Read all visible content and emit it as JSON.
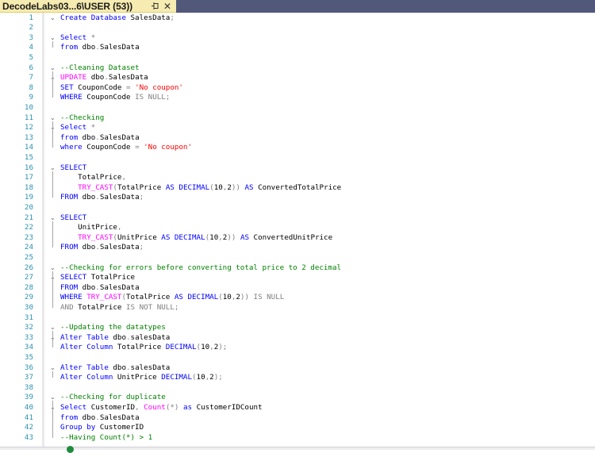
{
  "tab": {
    "title": "DecodeLabs03...6\\USER (53))",
    "pin_icon": "pin-icon",
    "close_icon": "close-icon",
    "close_glyph": "✕",
    "active_color": "#f6ebb0"
  },
  "editor": {
    "fold_glyph": "⌄",
    "lines": [
      {
        "n": "1",
        "fold": true,
        "tokens": [
          [
            "kw",
            "Create Database "
          ],
          [
            "t",
            "SalesData"
          ],
          [
            "op",
            ";"
          ]
        ]
      },
      {
        "n": "2",
        "fold": false,
        "tokens": []
      },
      {
        "n": "3",
        "fold": true,
        "tokens": [
          [
            "kw",
            "Select "
          ],
          [
            "op",
            "*"
          ]
        ]
      },
      {
        "n": "4",
        "fold": false,
        "tokens": [
          [
            "kw",
            "from "
          ],
          [
            "t",
            "dbo"
          ],
          [
            "op",
            "."
          ],
          [
            "t",
            "SalesData"
          ]
        ]
      },
      {
        "n": "5",
        "fold": false,
        "tokens": []
      },
      {
        "n": "6",
        "fold": true,
        "tokens": [
          [
            "cm",
            "--Cleaning Dataset"
          ]
        ]
      },
      {
        "n": "7",
        "fold": true,
        "tokens": [
          [
            "fn",
            "UPDATE "
          ],
          [
            "t",
            "dbo"
          ],
          [
            "op",
            "."
          ],
          [
            "t",
            "SalesData"
          ]
        ]
      },
      {
        "n": "8",
        "fold": false,
        "tokens": [
          [
            "kw",
            "SET "
          ],
          [
            "t",
            "CouponCode "
          ],
          [
            "op",
            "= "
          ],
          [
            "str",
            "'No coupon'"
          ]
        ]
      },
      {
        "n": "9",
        "fold": false,
        "tokens": [
          [
            "kw",
            "WHERE "
          ],
          [
            "t",
            "CouponCode "
          ],
          [
            "op",
            "IS NULL;"
          ]
        ]
      },
      {
        "n": "10",
        "fold": false,
        "tokens": []
      },
      {
        "n": "11",
        "fold": true,
        "tokens": [
          [
            "cm",
            "--Checking"
          ]
        ]
      },
      {
        "n": "12",
        "fold": true,
        "tokens": [
          [
            "kw",
            "Select "
          ],
          [
            "op",
            "*"
          ]
        ]
      },
      {
        "n": "13",
        "fold": false,
        "tokens": [
          [
            "kw",
            "from "
          ],
          [
            "t",
            "dbo"
          ],
          [
            "op",
            "."
          ],
          [
            "t",
            "SalesData"
          ]
        ]
      },
      {
        "n": "14",
        "fold": false,
        "tokens": [
          [
            "kw",
            "where "
          ],
          [
            "t",
            "CouponCode "
          ],
          [
            "op",
            "= "
          ],
          [
            "str",
            "'No coupon'"
          ]
        ]
      },
      {
        "n": "15",
        "fold": false,
        "tokens": []
      },
      {
        "n": "16",
        "fold": true,
        "tokens": [
          [
            "kw",
            "SELECT"
          ]
        ]
      },
      {
        "n": "17",
        "fold": false,
        "tokens": [
          [
            "t",
            "    TotalPrice"
          ],
          [
            "op",
            ","
          ]
        ]
      },
      {
        "n": "18",
        "fold": false,
        "tokens": [
          [
            "t",
            "    "
          ],
          [
            "fn",
            "TRY_CAST"
          ],
          [
            "op",
            "("
          ],
          [
            "t",
            "TotalPrice "
          ],
          [
            "kw",
            "AS DECIMAL"
          ],
          [
            "op",
            "("
          ],
          [
            "t",
            "10"
          ],
          [
            "op",
            ","
          ],
          [
            "t",
            "2"
          ],
          [
            "op",
            "))"
          ],
          [
            "kw",
            " AS "
          ],
          [
            "t",
            "ConvertedTotalPrice"
          ]
        ]
      },
      {
        "n": "19",
        "fold": false,
        "tokens": [
          [
            "kw",
            "FROM "
          ],
          [
            "t",
            "dbo"
          ],
          [
            "op",
            "."
          ],
          [
            "t",
            "SalesData"
          ],
          [
            "op",
            ";"
          ]
        ]
      },
      {
        "n": "20",
        "fold": false,
        "tokens": []
      },
      {
        "n": "21",
        "fold": true,
        "tokens": [
          [
            "kw",
            "SELECT"
          ]
        ]
      },
      {
        "n": "22",
        "fold": false,
        "tokens": [
          [
            "t",
            "    UnitPrice"
          ],
          [
            "op",
            ","
          ]
        ]
      },
      {
        "n": "23",
        "fold": false,
        "tokens": [
          [
            "t",
            "    "
          ],
          [
            "fn",
            "TRY_CAST"
          ],
          [
            "op",
            "("
          ],
          [
            "t",
            "UnitPrice "
          ],
          [
            "kw",
            "AS DECIMAL"
          ],
          [
            "op",
            "("
          ],
          [
            "t",
            "10"
          ],
          [
            "op",
            ","
          ],
          [
            "t",
            "2"
          ],
          [
            "op",
            "))"
          ],
          [
            "kw",
            " AS "
          ],
          [
            "t",
            "ConvertedUnitPrice"
          ]
        ]
      },
      {
        "n": "24",
        "fold": false,
        "tokens": [
          [
            "kw",
            "FROM "
          ],
          [
            "t",
            "dbo"
          ],
          [
            "op",
            "."
          ],
          [
            "t",
            "SalesData"
          ],
          [
            "op",
            ";"
          ]
        ]
      },
      {
        "n": "25",
        "fold": false,
        "tokens": []
      },
      {
        "n": "26",
        "fold": true,
        "tokens": [
          [
            "cm",
            "--Checking for errors before converting total price to 2 decimal"
          ]
        ]
      },
      {
        "n": "27",
        "fold": true,
        "tokens": [
          [
            "kw",
            "SELECT "
          ],
          [
            "t",
            "TotalPrice"
          ]
        ]
      },
      {
        "n": "28",
        "fold": false,
        "tokens": [
          [
            "kw",
            "FROM "
          ],
          [
            "t",
            "dbo"
          ],
          [
            "op",
            "."
          ],
          [
            "t",
            "SalesData"
          ]
        ]
      },
      {
        "n": "29",
        "fold": false,
        "tokens": [
          [
            "kw",
            "WHERE "
          ],
          [
            "fn",
            "TRY_CAST"
          ],
          [
            "op",
            "("
          ],
          [
            "t",
            "TotalPrice "
          ],
          [
            "kw",
            "AS DECIMAL"
          ],
          [
            "op",
            "("
          ],
          [
            "t",
            "10"
          ],
          [
            "op",
            ","
          ],
          [
            "t",
            "2"
          ],
          [
            "op",
            "))"
          ],
          [
            "op",
            " IS NULL"
          ]
        ]
      },
      {
        "n": "30",
        "fold": false,
        "tokens": [
          [
            "op",
            "AND "
          ],
          [
            "t",
            "TotalPrice "
          ],
          [
            "op",
            "IS NOT NULL;"
          ]
        ]
      },
      {
        "n": "31",
        "fold": false,
        "tokens": []
      },
      {
        "n": "32",
        "fold": true,
        "tokens": [
          [
            "cm",
            "--Updating the datatypes"
          ]
        ]
      },
      {
        "n": "33",
        "fold": true,
        "tokens": [
          [
            "kw",
            "Alter Table "
          ],
          [
            "t",
            "dbo"
          ],
          [
            "op",
            "."
          ],
          [
            "t",
            "salesData"
          ]
        ]
      },
      {
        "n": "34",
        "fold": false,
        "tokens": [
          [
            "kw",
            "Alter Column "
          ],
          [
            "t",
            "TotalPrice "
          ],
          [
            "kw",
            "DECIMAL"
          ],
          [
            "op",
            "("
          ],
          [
            "t",
            "10"
          ],
          [
            "op",
            ","
          ],
          [
            "t",
            "2"
          ],
          [
            "op",
            ");"
          ]
        ]
      },
      {
        "n": "35",
        "fold": false,
        "tokens": []
      },
      {
        "n": "36",
        "fold": true,
        "tokens": [
          [
            "kw",
            "Alter Table "
          ],
          [
            "t",
            "dbo"
          ],
          [
            "op",
            "."
          ],
          [
            "t",
            "salesData"
          ]
        ]
      },
      {
        "n": "37",
        "fold": false,
        "tokens": [
          [
            "kw",
            "Alter Column "
          ],
          [
            "t",
            "UnitPrice "
          ],
          [
            "kw",
            "DECIMAL"
          ],
          [
            "op",
            "("
          ],
          [
            "t",
            "10"
          ],
          [
            "op",
            ","
          ],
          [
            "t",
            "2"
          ],
          [
            "op",
            ");"
          ]
        ]
      },
      {
        "n": "38",
        "fold": false,
        "tokens": []
      },
      {
        "n": "39",
        "fold": true,
        "tokens": [
          [
            "cm",
            "--Checking for duplicate"
          ]
        ]
      },
      {
        "n": "40",
        "fold": true,
        "tokens": [
          [
            "kw",
            "Select "
          ],
          [
            "t",
            "CustomerID"
          ],
          [
            "op",
            ", "
          ],
          [
            "fn",
            "Count"
          ],
          [
            "op",
            "(*) "
          ],
          [
            "kw",
            "as "
          ],
          [
            "t",
            "CustomerIDCount"
          ]
        ]
      },
      {
        "n": "41",
        "fold": false,
        "tokens": [
          [
            "kw",
            "from "
          ],
          [
            "t",
            "dbo"
          ],
          [
            "op",
            "."
          ],
          [
            "t",
            "SalesData"
          ]
        ]
      },
      {
        "n": "42",
        "fold": false,
        "tokens": [
          [
            "kw",
            "Group by "
          ],
          [
            "t",
            "CustomerID"
          ]
        ]
      },
      {
        "n": "43",
        "fold": false,
        "tokens": [
          [
            "cm",
            "--Having Count(*) > 1"
          ]
        ]
      }
    ]
  },
  "colors": {
    "keyword": "#0000ff",
    "function": "#ff00ff",
    "string": "#ff0000",
    "comment": "#008000",
    "operator": "#808080",
    "line_number": "#2b91af",
    "tab_strip": "#52587a"
  },
  "statusbar": {
    "status_icon": "check-circle-icon"
  }
}
